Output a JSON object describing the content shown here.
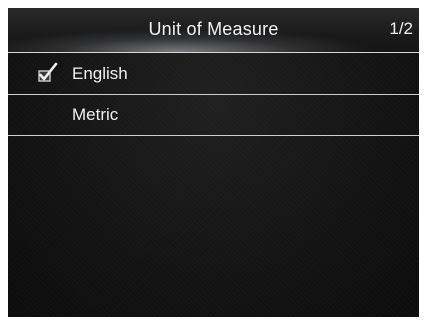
{
  "header": {
    "title": "Unit of Measure",
    "page": "1/2"
  },
  "menu": {
    "items": [
      {
        "label": "English",
        "selected": true,
        "icon": "checkbox-checked-icon"
      },
      {
        "label": "Metric",
        "selected": false
      }
    ]
  },
  "colors": {
    "background": "#141414",
    "text": "#f0f0f0",
    "divider": "#cfcfcf"
  }
}
